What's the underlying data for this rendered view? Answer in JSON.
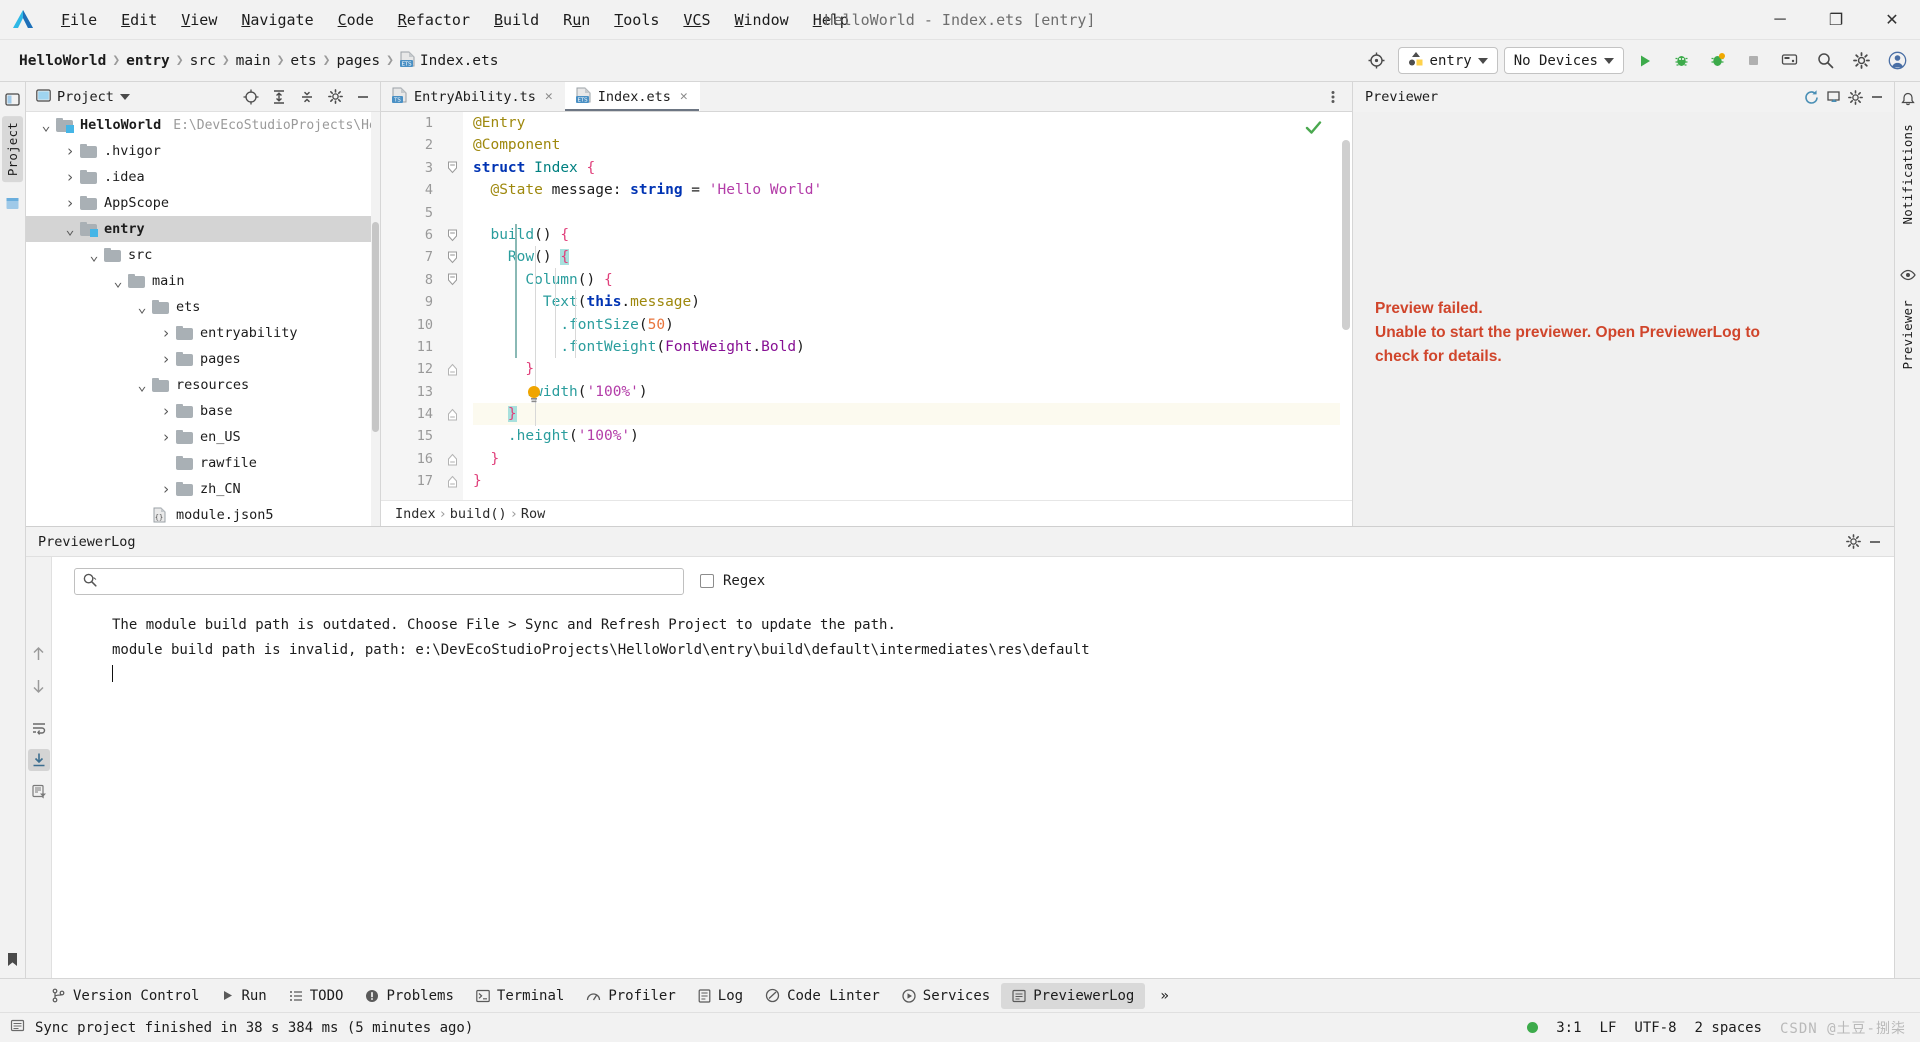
{
  "titlebar": {
    "menus": [
      "File",
      "Edit",
      "View",
      "Navigate",
      "Code",
      "Refactor",
      "Build",
      "Run",
      "Tools",
      "VCS",
      "Window",
      "Help"
    ],
    "window_title": "HelloWorld - Index.ets [entry]",
    "minimize": "─",
    "maximize": "❐",
    "close": "✕"
  },
  "navbar": {
    "breadcrumbs": [
      "HelloWorld",
      "entry",
      "src",
      "main",
      "ets",
      "pages"
    ],
    "file": "Index.ets",
    "file_badge": "ETS",
    "target_module": "entry",
    "device": "No Devices",
    "icons": [
      "target-icon",
      "run-icon",
      "debug-icon",
      "profile-icon",
      "stop-icon",
      "device-manager-icon",
      "search-icon",
      "settings-icon",
      "account-icon"
    ]
  },
  "left_stripe": {
    "tabs": [
      "Project"
    ]
  },
  "right_stripe": {
    "tabs": [
      "Notifications",
      "Previewer"
    ]
  },
  "project": {
    "title": "Project",
    "tree": [
      {
        "indent": 0,
        "arrow": "down",
        "label": "HelloWorld",
        "bold": true,
        "path": "E:\\DevEcoStudioProjects\\Hell",
        "kind": "module",
        "selected": false
      },
      {
        "indent": 1,
        "arrow": "right",
        "label": ".hvigor",
        "bold": false,
        "path": "",
        "kind": "folder",
        "selected": false
      },
      {
        "indent": 1,
        "arrow": "right",
        "label": ".idea",
        "bold": false,
        "path": "",
        "kind": "folder",
        "selected": false
      },
      {
        "indent": 1,
        "arrow": "right",
        "label": "AppScope",
        "bold": false,
        "path": "",
        "kind": "folder",
        "selected": false
      },
      {
        "indent": 1,
        "arrow": "down",
        "label": "entry",
        "bold": true,
        "path": "",
        "kind": "module",
        "selected": true
      },
      {
        "indent": 2,
        "arrow": "down",
        "label": "src",
        "bold": false,
        "path": "",
        "kind": "folder",
        "selected": false
      },
      {
        "indent": 3,
        "arrow": "down",
        "label": "main",
        "bold": false,
        "path": "",
        "kind": "folder",
        "selected": false
      },
      {
        "indent": 4,
        "arrow": "down",
        "label": "ets",
        "bold": false,
        "path": "",
        "kind": "folder",
        "selected": false
      },
      {
        "indent": 5,
        "arrow": "right",
        "label": "entryability",
        "bold": false,
        "path": "",
        "kind": "folder",
        "selected": false
      },
      {
        "indent": 5,
        "arrow": "right",
        "label": "pages",
        "bold": false,
        "path": "",
        "kind": "folder",
        "selected": false
      },
      {
        "indent": 4,
        "arrow": "down",
        "label": "resources",
        "bold": false,
        "path": "",
        "kind": "folder",
        "selected": false
      },
      {
        "indent": 5,
        "arrow": "right",
        "label": "base",
        "bold": false,
        "path": "",
        "kind": "folder",
        "selected": false
      },
      {
        "indent": 5,
        "arrow": "right",
        "label": "en_US",
        "bold": false,
        "path": "",
        "kind": "folder",
        "selected": false
      },
      {
        "indent": 5,
        "arrow": "none",
        "label": "rawfile",
        "bold": false,
        "path": "",
        "kind": "folder",
        "selected": false
      },
      {
        "indent": 5,
        "arrow": "right",
        "label": "zh_CN",
        "bold": false,
        "path": "",
        "kind": "folder",
        "selected": false
      },
      {
        "indent": 4,
        "arrow": "none",
        "label": "module.json5",
        "bold": false,
        "path": "",
        "kind": "json",
        "selected": false
      }
    ]
  },
  "editor": {
    "tabs": [
      {
        "label": "EntryAbility.ts",
        "badge": "TS",
        "active": false
      },
      {
        "label": "Index.ets",
        "badge": "ETS",
        "active": true
      }
    ],
    "lines": [
      {
        "n": 1,
        "text": "@Entry"
      },
      {
        "n": 2,
        "text": "@Component"
      },
      {
        "n": 3,
        "text": "struct Index {"
      },
      {
        "n": 4,
        "text": "  @State message: string = 'Hello World'"
      },
      {
        "n": 5,
        "text": ""
      },
      {
        "n": 6,
        "text": "  build() {"
      },
      {
        "n": 7,
        "text": "    Row() {"
      },
      {
        "n": 8,
        "text": "      Column() {"
      },
      {
        "n": 9,
        "text": "        Text(this.message)"
      },
      {
        "n": 10,
        "text": "          .fontSize(50)"
      },
      {
        "n": 11,
        "text": "          .fontWeight(FontWeight.Bold)"
      },
      {
        "n": 12,
        "text": "      }"
      },
      {
        "n": 13,
        "text": "      .width('100%')"
      },
      {
        "n": 14,
        "text": "    }"
      },
      {
        "n": 15,
        "text": "    .height('100%')"
      },
      {
        "n": 16,
        "text": "  }"
      },
      {
        "n": 17,
        "text": "}"
      }
    ],
    "breadcrumb": [
      "Index",
      "build()",
      "Row"
    ],
    "inspection_status": "ok-check"
  },
  "previewer": {
    "title": "Previewer",
    "error_line1": "Preview failed.",
    "error_line2": "Unable to start the previewer. Open PreviewerLog to",
    "error_line3": "check for details.",
    "error_color": "#d0452b",
    "header_icons": [
      "refresh-icon",
      "inspector-icon",
      "settings-icon",
      "minimize-icon"
    ]
  },
  "previewer_log": {
    "title": "PreviewerLog",
    "search_value": "",
    "search_placeholder": "",
    "regex_label": "Regex",
    "regex_checked": false,
    "lines": [
      "The module build path is outdated. Choose File > Sync and Refresh Project to update the path.",
      "module build path is invalid, path: e:\\DevEcoStudioProjects\\HelloWorld\\entry\\build\\default\\intermediates\\res\\default"
    ],
    "stripe_tabs": [
      "Structure",
      "Bookmarks"
    ],
    "stripe_icons": [
      "arrow-up-icon",
      "arrow-down-icon",
      "soft-wrap-icon",
      "scroll-end-icon",
      "filter-icon"
    ]
  },
  "toolwindow_bar": {
    "items": [
      {
        "label": "Version Control",
        "icon": "branch-icon",
        "active": false
      },
      {
        "label": "Run",
        "icon": "run-icon",
        "active": false
      },
      {
        "label": "TODO",
        "icon": "todo-icon",
        "active": false
      },
      {
        "label": "Problems",
        "icon": "problems-icon",
        "active": false
      },
      {
        "label": "Terminal",
        "icon": "terminal-icon",
        "active": false
      },
      {
        "label": "Profiler",
        "icon": "profiler-icon",
        "active": false
      },
      {
        "label": "Log",
        "icon": "log-icon",
        "active": false
      },
      {
        "label": "Code Linter",
        "icon": "linter-icon",
        "active": false
      },
      {
        "label": "Services",
        "icon": "services-icon",
        "active": false
      },
      {
        "label": "PreviewerLog",
        "icon": "previewerlog-icon",
        "active": true
      }
    ],
    "more": "»"
  },
  "statusbar": {
    "message": "Sync project finished in 38 s 384 ms (5 minutes ago)",
    "caret_position": "3:1",
    "line_separator": "LF",
    "encoding": "UTF-8",
    "indent": "2 spaces",
    "watermark": "CSDN @土豆-捌柒"
  }
}
